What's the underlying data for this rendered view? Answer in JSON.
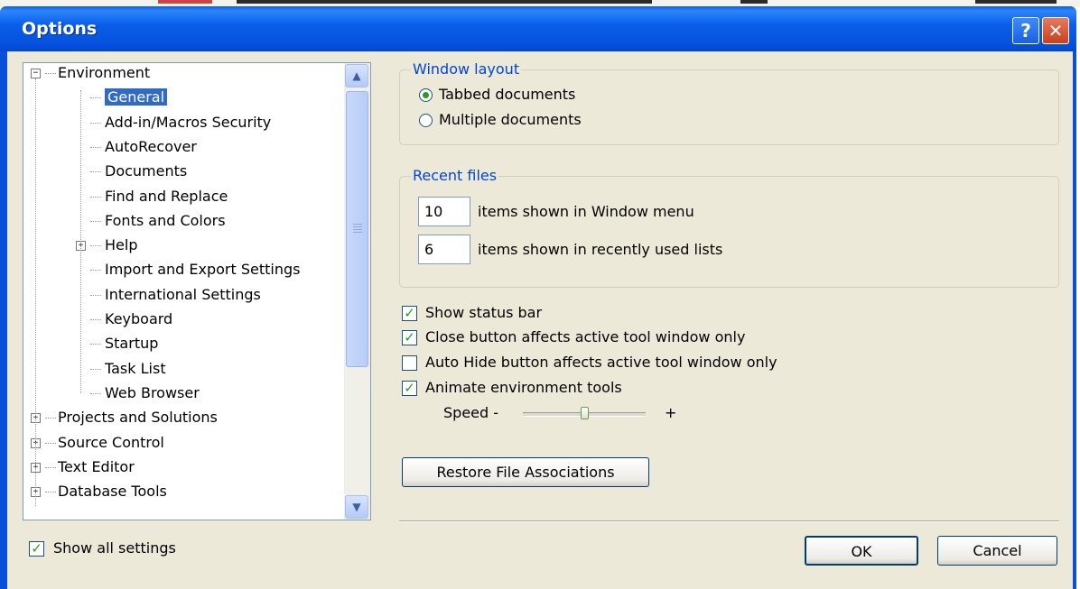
{
  "window": {
    "title": "Options",
    "help_glyph": "?",
    "close_glyph": "✕"
  },
  "tree": {
    "items": [
      {
        "label": "Environment",
        "level": 0,
        "expander": "−"
      },
      {
        "label": "General",
        "level": 1,
        "selected": true
      },
      {
        "label": "Add-in/Macros Security",
        "level": 1
      },
      {
        "label": "AutoRecover",
        "level": 1
      },
      {
        "label": "Documents",
        "level": 1
      },
      {
        "label": "Find and Replace",
        "level": 1
      },
      {
        "label": "Fonts and Colors",
        "level": 1
      },
      {
        "label": "Help",
        "level": 1,
        "expander": "+"
      },
      {
        "label": "Import and Export Settings",
        "level": 1
      },
      {
        "label": "International Settings",
        "level": 1
      },
      {
        "label": "Keyboard",
        "level": 1
      },
      {
        "label": "Startup",
        "level": 1
      },
      {
        "label": "Task List",
        "level": 1
      },
      {
        "label": "Web Browser",
        "level": 1
      },
      {
        "label": "Projects and Solutions",
        "level": 0,
        "expander": "+"
      },
      {
        "label": "Source Control",
        "level": 0,
        "expander": "+"
      },
      {
        "label": "Text Editor",
        "level": 0,
        "expander": "+"
      },
      {
        "label": "Database Tools",
        "level": 0,
        "expander": "+"
      }
    ],
    "scroll_up_icon": "▲",
    "scroll_down_icon": "▼"
  },
  "window_layout": {
    "legend": "Window layout",
    "options": [
      {
        "label": "Tabbed documents",
        "selected": true
      },
      {
        "label": "Multiple documents",
        "selected": false
      }
    ]
  },
  "recent_files": {
    "legend": "Recent files",
    "window_menu_value": "10",
    "window_menu_label": "items shown in Window menu",
    "recent_lists_value": "6",
    "recent_lists_label": "items shown in recently used lists"
  },
  "checkboxes": [
    {
      "label": "Show status bar",
      "checked": true
    },
    {
      "label": "Close button affects active tool window only",
      "checked": true
    },
    {
      "label": "Auto Hide button affects active tool window only",
      "checked": false
    },
    {
      "label": "Animate environment tools",
      "checked": true
    }
  ],
  "speed": {
    "label": "Speed -",
    "plus": "+",
    "level_fraction": 0.5
  },
  "restore_button": "Restore File Associations",
  "show_all_settings": {
    "label": "Show all settings",
    "checked": true
  },
  "ok_button": "OK",
  "cancel_button": "Cancel",
  "check_glyph": "✓"
}
